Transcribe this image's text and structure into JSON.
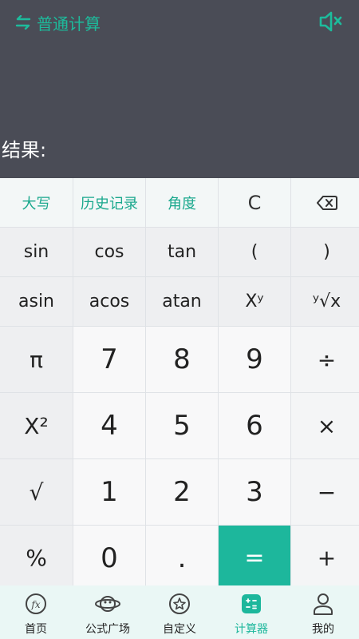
{
  "header": {
    "mode_label": "普通计算",
    "accent": "#1dbb9c"
  },
  "display": {
    "result_label": "结果:",
    "result_value": ""
  },
  "keypad": {
    "row1": [
      "大写",
      "历史记录",
      "角度",
      "C",
      "backspace"
    ],
    "row2": [
      "sin",
      "cos",
      "tan",
      "(",
      ")"
    ],
    "row3": [
      "asin",
      "acos",
      "atan",
      "Xʸ",
      "ʸ√x"
    ],
    "row4": [
      "π",
      "7",
      "8",
      "9",
      "÷"
    ],
    "row5": [
      "X²",
      "4",
      "5",
      "6",
      "×"
    ],
    "row6": [
      "√",
      "1",
      "2",
      "3",
      "−"
    ],
    "row7": [
      "%",
      "0",
      ".",
      "=",
      "+"
    ]
  },
  "tabs": [
    {
      "label": "首页",
      "icon": "fx-icon"
    },
    {
      "label": "公式广场",
      "icon": "planet-icon"
    },
    {
      "label": "自定义",
      "icon": "star-badge-icon"
    },
    {
      "label": "计算器",
      "icon": "calculator-icon",
      "active": true
    },
    {
      "label": "我的",
      "icon": "person-icon"
    }
  ]
}
